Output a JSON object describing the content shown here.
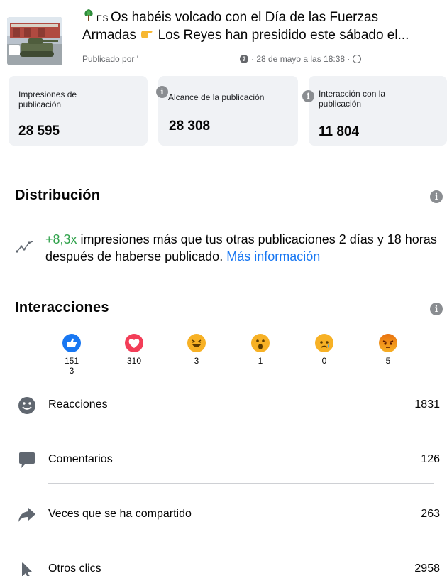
{
  "post": {
    "title_line1": "Os habéis volcado con el Día de las Fuerzas",
    "title_tag": "ES",
    "title_line2": "Armadas",
    "title_line2_rest": "Los Reyes han presidido este sábado el...",
    "published_by": "Publicado por '",
    "date": "· 28 de mayo a las 18:38 ·"
  },
  "stats": [
    {
      "label": "Impresiones de publicación",
      "value": "28 595"
    },
    {
      "label": "Alcance de la publicación",
      "value": "28 308"
    },
    {
      "label": "Interacción con la publicación",
      "value": "11 804"
    }
  ],
  "distribution": {
    "title": "Distribución",
    "highlight": "+8,3x",
    "text": " impresiones más que tus otras publicaciones 2 días y 18 horas después de haberse publicado. ",
    "link": "Más información"
  },
  "interactions": {
    "title": "Interacciones",
    "reactions": [
      {
        "name": "like",
        "count": "151\n3"
      },
      {
        "name": "love",
        "count": "310"
      },
      {
        "name": "haha",
        "count": "3"
      },
      {
        "name": "wow",
        "count": "1"
      },
      {
        "name": "sad",
        "count": "0"
      },
      {
        "name": "angry",
        "count": "5"
      }
    ],
    "rows": [
      {
        "label": "Reacciones",
        "value": "1831",
        "icon": "smile-icon"
      },
      {
        "label": "Comentarios",
        "value": "126",
        "icon": "comment-icon"
      },
      {
        "label": "Veces que se ha compartido",
        "value": "263",
        "icon": "share-icon"
      },
      {
        "label": "Otros clics",
        "value": "2958",
        "icon": "cursor-icon"
      }
    ]
  },
  "colors": {
    "accent_green": "#31a24c",
    "link_blue": "#1877f2",
    "card_bg": "#f0f2f5",
    "info_grey": "#8a8d91"
  }
}
